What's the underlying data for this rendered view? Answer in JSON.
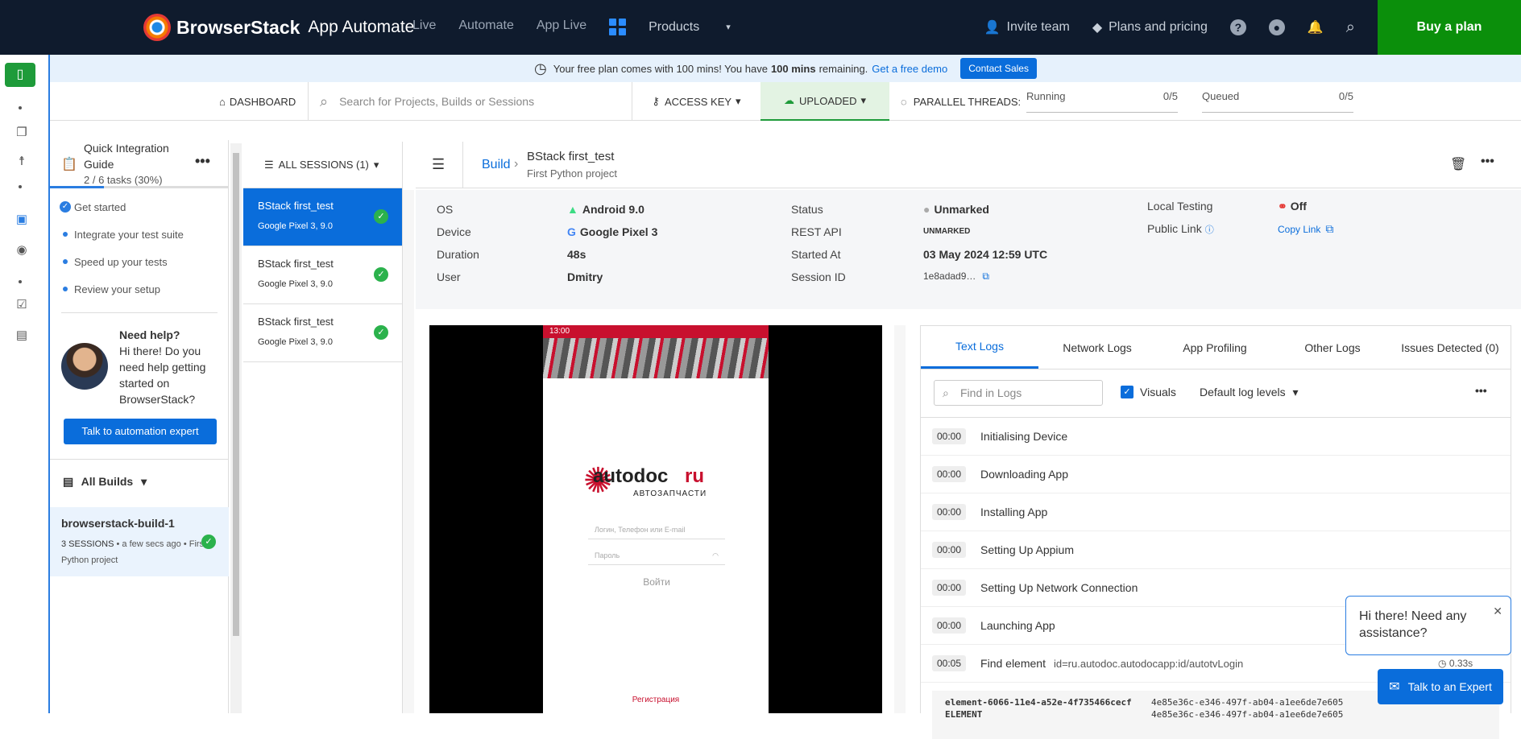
{
  "topbar": {
    "brand": "BrowserStack",
    "product": "App Automate",
    "nav": [
      "Live",
      "Automate",
      "App Live"
    ],
    "products_label": "Products",
    "invite": "Invite team",
    "plans": "Plans and pricing",
    "help_glyph": "?",
    "buy": "Buy a plan"
  },
  "banner": {
    "text_before": "Your free plan comes with 100 mins! You have",
    "mins": "100 mins",
    "text_after": "remaining.",
    "demo_link": "Get a free demo",
    "contact": "Contact Sales"
  },
  "toolbar": {
    "dashboard": "DASHBOARD",
    "search_placeholder": "Search for Projects, Builds or Sessions",
    "access_key": "ACCESS KEY",
    "uploaded": "UPLOADED",
    "parallel": "PARALLEL THREADS:",
    "running_label": "Running",
    "running_value": "0/5",
    "queued_label": "Queued",
    "queued_value": "0/5"
  },
  "guide": {
    "title_line1": "Quick Integration",
    "title_line2": "Guide",
    "progress_text": "2 / 6 tasks (30%)",
    "progress_fraction": 0.3,
    "steps": [
      "Get started",
      "Integrate your test suite",
      "Speed up your tests",
      "Review your setup"
    ],
    "help_title": "Need help?",
    "help_body": "Hi there! Do you need help getting started on BrowserStack?",
    "talk_button": "Talk to automation expert",
    "all_builds": "All Builds",
    "build_name": "browserstack-build-1",
    "build_sessions": "3 SESSIONS",
    "build_time": "a few secs ago",
    "build_project": "First Python project"
  },
  "sessions": {
    "header": "ALL SESSIONS (1)",
    "items": [
      {
        "name": "BStack first_test",
        "device": "Google Pixel 3, 9.0"
      },
      {
        "name": "BStack first_test",
        "device": "Google Pixel 3, 9.0"
      },
      {
        "name": "BStack first_test",
        "device": "Google Pixel 3, 9.0"
      }
    ]
  },
  "main": {
    "breadcrumb_build": "Build",
    "session_title": "BStack first_test",
    "project": "First Python project"
  },
  "details": {
    "os_label": "OS",
    "os_value": "Android 9.0",
    "device_label": "Device",
    "device_value": "Google Pixel 3",
    "duration_label": "Duration",
    "duration_value": "48s",
    "user_label": "User",
    "user_value": "Dmitry",
    "status_label": "Status",
    "status_value": "Unmarked",
    "rest_label": "REST API",
    "rest_value": "UNMARKED",
    "started_label": "Started At",
    "started_value": "03 May 2024 12:59 UTC",
    "session_label": "Session ID",
    "session_value": "1e8adad9…",
    "local_label": "Local Testing",
    "local_value": "Off",
    "public_label": "Public Link",
    "copy_link": "Copy Link"
  },
  "phone": {
    "time": "13:00",
    "logo_main": "autodoc",
    "logo_ru": "ru",
    "logo_sub": "АВТОЗАПЧАСТИ",
    "login_placeholder": "Логин, Телефон или E-mail",
    "password_placeholder": "Пароль",
    "login_button": "Войти",
    "register": "Регистрация"
  },
  "logs": {
    "tabs": [
      "Text Logs",
      "Network Logs",
      "App Profiling",
      "Other Logs",
      "Issues Detected (0)"
    ],
    "find_placeholder": "Find in Logs",
    "visuals": "Visuals",
    "levels": "Default log levels",
    "rows": [
      {
        "time": "00:00",
        "text": "Initialising Device"
      },
      {
        "time": "00:00",
        "text": "Downloading App"
      },
      {
        "time": "00:00",
        "text": "Installing App"
      },
      {
        "time": "00:00",
        "text": "Setting Up Appium"
      },
      {
        "time": "00:00",
        "text": "Setting Up Network Connection"
      },
      {
        "time": "00:00",
        "text": "Launching App"
      },
      {
        "time": "00:05",
        "text": "Find element",
        "detail": "id=ru.autodoc.autodocapp:id/autotvLogin",
        "duration": "0.33s"
      }
    ],
    "code_key": "element-6066-11e4-a52e-4f735466cecf",
    "code_value": "4e85e36c-e346-497f-ab04-a1ee6de7e605",
    "code_key2": "ELEMENT",
    "code_value2": "4e85e36c-e346-497f-ab04-a1ee6de7e605"
  },
  "chat": {
    "popup": "Hi there! Need any assistance?",
    "button": "Talk to an Expert"
  }
}
